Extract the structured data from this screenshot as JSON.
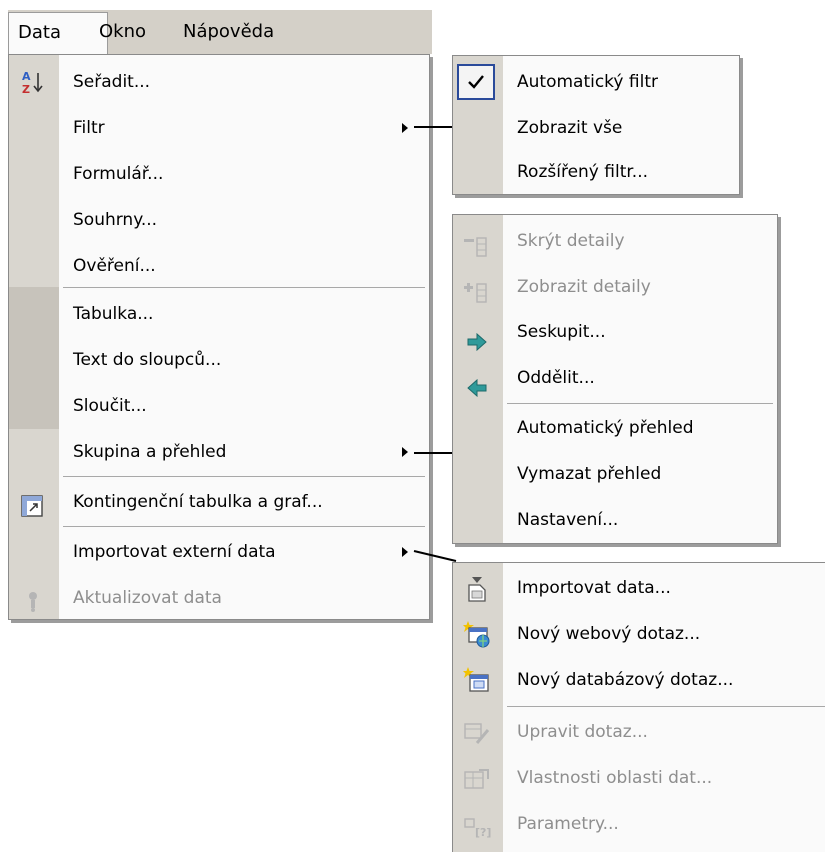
{
  "menubar": {
    "items": [
      {
        "label": "Data"
      },
      {
        "label": "Okno"
      },
      {
        "label": "Nápověda"
      }
    ]
  },
  "data_menu": {
    "items": [
      {
        "label": "Seřadit...",
        "icon": "sort-az-icon"
      },
      {
        "label": "Filtr",
        "submenu": true
      },
      {
        "label": "Formulář..."
      },
      {
        "label": "Souhrny..."
      },
      {
        "label": "Ověření..."
      },
      {
        "label": "Tabulka..."
      },
      {
        "label": "Text do sloupců..."
      },
      {
        "label": "Sloučit..."
      },
      {
        "label": "Skupina a přehled",
        "submenu": true
      },
      {
        "label": "Kontingenční tabulka a graf...",
        "icon": "pivot-table-icon"
      },
      {
        "label": "Importovat externí data",
        "submenu": true
      },
      {
        "label": "Aktualizovat data",
        "icon": "refresh-data-icon",
        "disabled": true
      }
    ]
  },
  "filter_menu": {
    "items": [
      {
        "label": "Automatický filtr",
        "checked": true,
        "icon": "checkmark-icon"
      },
      {
        "label": "Zobrazit vše"
      },
      {
        "label": "Rozšířený filtr..."
      }
    ]
  },
  "group_menu": {
    "items": [
      {
        "label": "Skrýt detaily",
        "icon": "hide-detail-icon",
        "disabled": true
      },
      {
        "label": "Zobrazit detaily",
        "icon": "show-detail-icon",
        "disabled": true
      },
      {
        "label": "Seskupit...",
        "icon": "group-arrow-right-icon"
      },
      {
        "label": "Oddělit...",
        "icon": "ungroup-arrow-left-icon"
      },
      {
        "label": "Automatický přehled"
      },
      {
        "label": "Vymazat přehled"
      },
      {
        "label": "Nastavení..."
      }
    ]
  },
  "import_menu": {
    "items": [
      {
        "label": "Importovat data...",
        "icon": "import-data-icon"
      },
      {
        "label": "Nový webový dotaz...",
        "icon": "new-web-query-icon"
      },
      {
        "label": "Nový databázový dotaz...",
        "icon": "new-database-query-icon"
      },
      {
        "label": "Upravit dotaz...",
        "icon": "edit-query-icon",
        "disabled": true
      },
      {
        "label": "Vlastnosti oblasti dat...",
        "icon": "data-range-properties-icon",
        "disabled": true
      },
      {
        "label": "Parametry...",
        "icon": "parameters-icon",
        "disabled": true
      }
    ]
  },
  "colors": {
    "menu_bg": "#fafafa",
    "gutter": "#d9d6cf",
    "disabled_text": "#8e8e8e",
    "arrow_teal": "#2f9a9a"
  }
}
